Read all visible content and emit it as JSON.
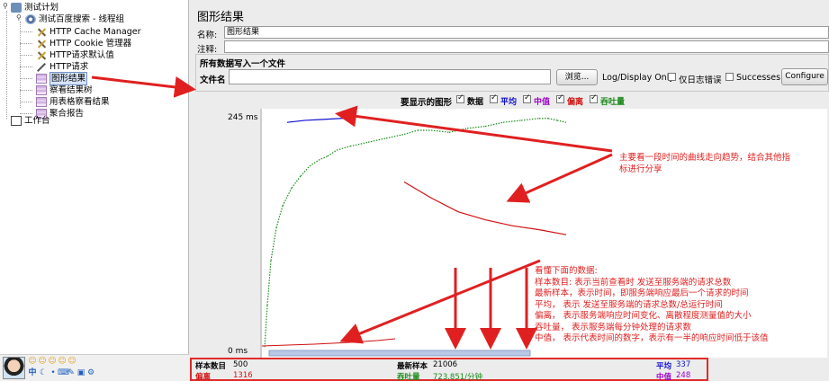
{
  "tree": {
    "items": [
      {
        "label": "测试计划"
      },
      {
        "label": "测试百度搜索 - 线程组"
      },
      {
        "label": "HTTP Cache Manager"
      },
      {
        "label": "HTTP Cookie 管理器"
      },
      {
        "label": "HTTP请求默认值"
      },
      {
        "label": "HTTP请求"
      },
      {
        "label": "图形结果"
      },
      {
        "label": "察看结果树"
      },
      {
        "label": "用表格察看结果"
      },
      {
        "label": "聚合报告"
      },
      {
        "label": "工作台"
      }
    ]
  },
  "panel": {
    "title": "图形结果",
    "name_label": "名称:",
    "name_value": "图形结果",
    "comment_label": "注释:",
    "file_section": "所有数据写入一个文件",
    "filename_label": "文件名",
    "browse": "浏览...",
    "logdisplay": "Log/Display Only:",
    "errors_only": "仅日志错误",
    "successes": "Successes",
    "configure": "Configure"
  },
  "graphs_header": "要显示的图形",
  "graph_options": [
    {
      "label": "数据",
      "color": "#000000"
    },
    {
      "label": "平均",
      "color": "#1010d0"
    },
    {
      "label": "中值",
      "color": "#9b00c8"
    },
    {
      "label": "偏离",
      "color": "#d01010"
    },
    {
      "label": "吞吐量",
      "color": "#1a8a1a"
    }
  ],
  "chart_data": {
    "type": "line",
    "ylim": [
      0,
      245
    ],
    "ytick_labels": [
      "245 ms",
      "0 ms"
    ],
    "series": [
      {
        "name": "吞吐量",
        "color": "#1a8a1a",
        "points": [
          [
            5,
            8
          ],
          [
            8,
            50
          ],
          [
            12,
            95
          ],
          [
            18,
            128
          ],
          [
            25,
            150
          ],
          [
            35,
            168
          ],
          [
            45,
            180
          ],
          [
            55,
            190
          ],
          [
            65,
            196
          ],
          [
            75,
            200
          ],
          [
            85,
            206
          ],
          [
            100,
            210
          ],
          [
            120,
            214
          ],
          [
            140,
            218
          ],
          [
            160,
            222
          ],
          [
            175,
            226
          ],
          [
            190,
            226
          ],
          [
            210,
            224
          ],
          [
            230,
            228
          ],
          [
            250,
            230
          ],
          [
            270,
            234
          ],
          [
            290,
            236
          ],
          [
            310,
            238
          ],
          [
            320,
            238
          ],
          [
            330,
            236
          ],
          [
            340,
            234
          ]
        ]
      },
      {
        "name": "偏离",
        "color": "#d01010",
        "points": [
          [
            160,
            174
          ],
          [
            190,
            158
          ],
          [
            220,
            144
          ],
          [
            250,
            136
          ],
          [
            280,
            130
          ],
          [
            310,
            126
          ],
          [
            340,
            121
          ]
        ]
      },
      {
        "name": "平均",
        "color": "#1010d0",
        "points": [
          [
            30,
            234
          ],
          [
            50,
            236
          ],
          [
            70,
            237
          ],
          [
            90,
            238
          ],
          [
            100,
            238
          ]
        ]
      }
    ]
  },
  "stats": {
    "samples_label": "样本数目",
    "samples_value": "500",
    "latest_label": "最新样本",
    "latest_value": "21006",
    "avg_label": "平均",
    "avg_value": "337",
    "dev_label": "偏离",
    "dev_value": "1316",
    "thr_label": "吞吐量",
    "thr_value": "723.851/分钟",
    "med_label": "中值",
    "med_value": "248"
  },
  "annotations": {
    "trend": "主要看一段时间的曲线走向趋势，结合其他指\n标进行分享",
    "data_lines": [
      "看懂下面的数据:",
      "样本数目: 表示当前查看时 发送至服务端的请求总数",
      "最新样本，表示时间，即服务端响应最后一个请求的时间",
      "平均，  表示 发送至服务端的请求总数/总运行时间",
      "偏离，  表示服务端响应时间变化、离散程度测量值的大小",
      "吞吐量，  表示服务端每分钟处理的请求数",
      "中值，  表示代表时间的数字，表示有一半的响应时间低于该值"
    ]
  },
  "colors": {
    "accent": "#e02020"
  }
}
